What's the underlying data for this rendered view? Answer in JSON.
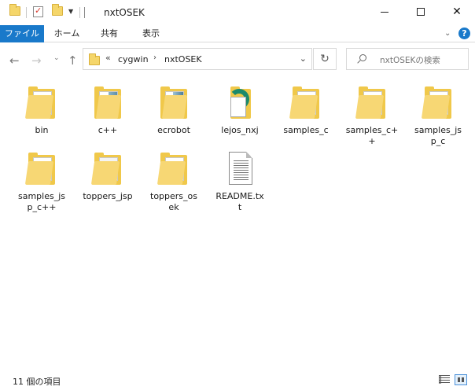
{
  "window": {
    "title": "nxtOSEK"
  },
  "ribbon": {
    "tabs": [
      "ファイル",
      "ホーム",
      "共有",
      "表示"
    ]
  },
  "address": {
    "overflow": "«",
    "crumbs": [
      "cygwin",
      "nxtOSEK"
    ],
    "search_placeholder": "nxtOSEKの検索"
  },
  "items": [
    {
      "name": "bin",
      "type": "folder"
    },
    {
      "name": "c++",
      "type": "folder-open"
    },
    {
      "name": "ecrobot",
      "type": "folder-open"
    },
    {
      "name": "lejos_nxj",
      "type": "folder-lejos"
    },
    {
      "name": "samples_c",
      "type": "folder"
    },
    {
      "name": "samples_c+\n+",
      "type": "folder"
    },
    {
      "name": "samples_js\np_c",
      "type": "folder"
    },
    {
      "name": "samples_js\np_c++",
      "type": "folder"
    },
    {
      "name": "toppers_jsp",
      "type": "folder-plain"
    },
    {
      "name": "toppers_os\nek",
      "type": "folder"
    },
    {
      "name": "README.tx\nt",
      "type": "text-file"
    }
  ],
  "status": {
    "count": "11 個の項目"
  },
  "colors": {
    "accent": "#1979ca",
    "folder": "#f0c84a"
  }
}
